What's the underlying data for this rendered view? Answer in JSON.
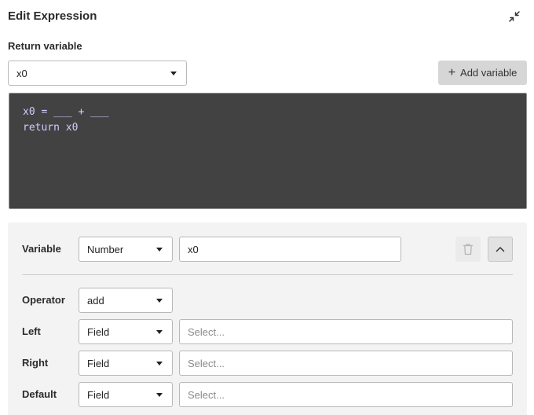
{
  "header": {
    "title": "Edit Expression"
  },
  "return_variable": {
    "label": "Return variable",
    "selected": "x0",
    "add_button": "Add variable"
  },
  "code": {
    "text": "x0 = ___ + ___\nreturn x0"
  },
  "variable": {
    "label": "Variable",
    "type": "Number",
    "name": "x0"
  },
  "operator": {
    "label": "Operator",
    "value": "add"
  },
  "left": {
    "label": "Left",
    "type": "Field",
    "placeholder": "Select..."
  },
  "right": {
    "label": "Right",
    "type": "Field",
    "placeholder": "Select..."
  },
  "default": {
    "label": "Default",
    "type": "Field",
    "placeholder": "Select..."
  },
  "icons": {
    "collapse": "collapse-arrows-icon",
    "trash": "trash-icon",
    "chevron": "chevron-up-icon",
    "caret": "caret-down-icon",
    "plus": "plus-icon"
  },
  "colors": {
    "code_bg": "#424242",
    "code_text": "#d7c9ff",
    "panel_bg": "#f3f3f3"
  }
}
